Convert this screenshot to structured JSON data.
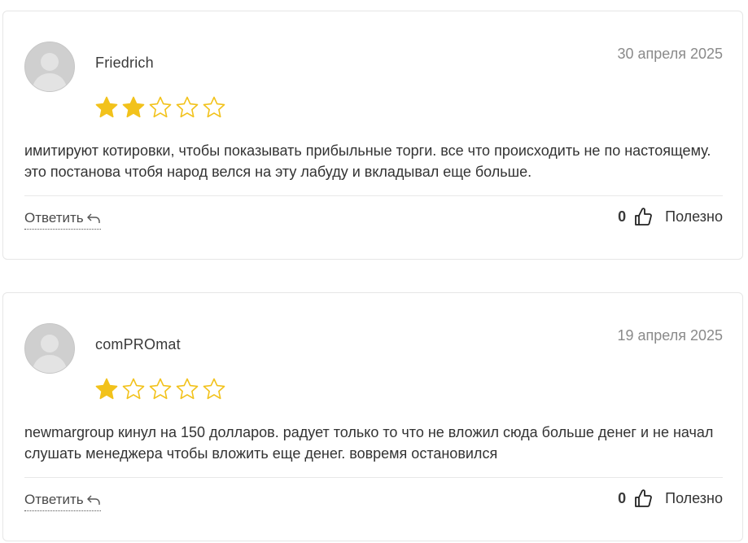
{
  "reviews": [
    {
      "author": "Friedrich",
      "date": "30 апреля 2025",
      "rating": 2,
      "rating_max": 5,
      "text": "имитируют котировки, чтобы показывать прибыльные торги. все что происходить не по настоящему. это постанова чтобя народ велся на эту лабуду и вкладывал еще больше.",
      "reply_label": "Ответить",
      "helpful_count": "0",
      "helpful_label": "Полезно"
    },
    {
      "author": "comPROmat",
      "date": "19 апреля 2025",
      "rating": 1,
      "rating_max": 5,
      "text": "newmargroup кинул на 150 долларов. радует только то что не вложил сюда больше денег и не начал слушать менеджера чтобы вложить еще денег. вовремя остановился",
      "reply_label": "Ответить",
      "helpful_count": "0",
      "helpful_label": "Полезно"
    }
  ],
  "colors": {
    "star_filled": "#F2C21B",
    "star_outline": "#F2C21B",
    "border": "#e6e6e6"
  },
  "icons": {
    "avatar": "default-user-avatar-icon",
    "star": "star-icon",
    "reply": "reply-arrow-icon",
    "thumb": "thumbs-up-icon"
  }
}
